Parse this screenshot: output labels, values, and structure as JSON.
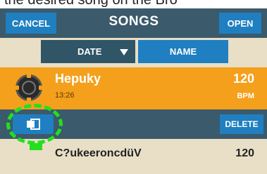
{
  "caption": {
    "text": "the desired song on the Bro"
  },
  "header": {
    "cancel_label": "CANCEL",
    "title": "SONGS",
    "open_label": "OPEN"
  },
  "sort": {
    "date_label": "DATE",
    "name_label": "NAME",
    "active": "DATE"
  },
  "selected_song": {
    "name": "Hepuky",
    "time": "13:26",
    "bpm": "120",
    "bpm_unit": "BPM"
  },
  "actions": {
    "delete_label": "DELETE"
  },
  "next_song": {
    "name": "C?ukeeroncdüV",
    "bpm": "120"
  },
  "colors": {
    "accent": "#1f7fc1",
    "selected_row": "#f4a01c",
    "highlight": "#22e01d",
    "header_bg": "#3b5a6b"
  }
}
